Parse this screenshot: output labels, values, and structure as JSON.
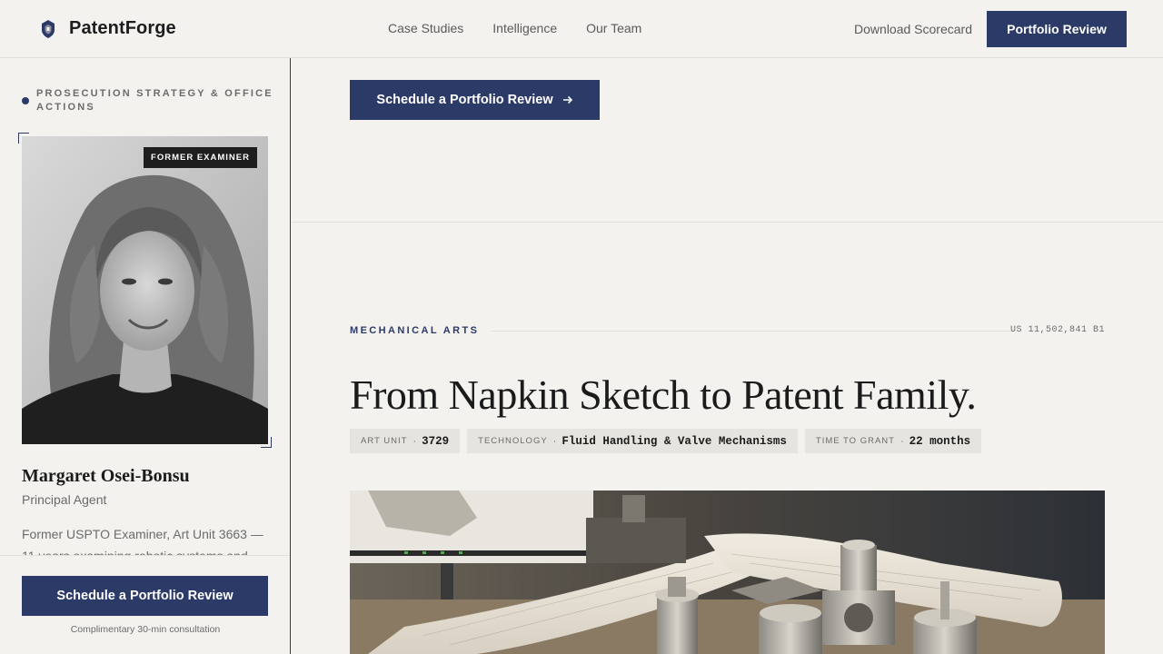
{
  "brand": {
    "name": "PatentForge"
  },
  "nav": {
    "items": [
      "Case Studies",
      "Intelligence",
      "Our Team"
    ]
  },
  "header": {
    "download_label": "Download Scorecard",
    "cta_label": "Portfolio Review"
  },
  "sidebar": {
    "eyebrow": "PROSECUTION STRATEGY & OFFICE ACTIONS",
    "badge": "FORMER EXAMINER",
    "name": "Margaret Osei-Bonsu",
    "role": "Principal Agent",
    "bio": "Former USPTO Examiner, Art Unit 3663 — 11 years examining robotic systems and",
    "cta_label": "Schedule a Portfolio Review",
    "consult_note": "Complimentary 30-min consultation"
  },
  "main": {
    "hero_cta_label": "Schedule a Portfolio Review",
    "section_label": "MECHANICAL ARTS",
    "patent_number": "US 11,502,841 B1",
    "headline": "From Napkin Sketch to Patent Family.",
    "chips": [
      {
        "key": "ART UNIT",
        "value": "3729"
      },
      {
        "key": "TECHNOLOGY",
        "value": "Fluid Handling & Valve Mechanisms"
      },
      {
        "key": "TIME TO GRANT",
        "value": "22 months"
      }
    ]
  },
  "colors": {
    "accent": "#2b3a67",
    "background": "#f3f2ef",
    "badge": "#1e1e1e"
  },
  "icons": {
    "logo": "shield-logo-icon",
    "arrow": "arrow-right-icon"
  }
}
